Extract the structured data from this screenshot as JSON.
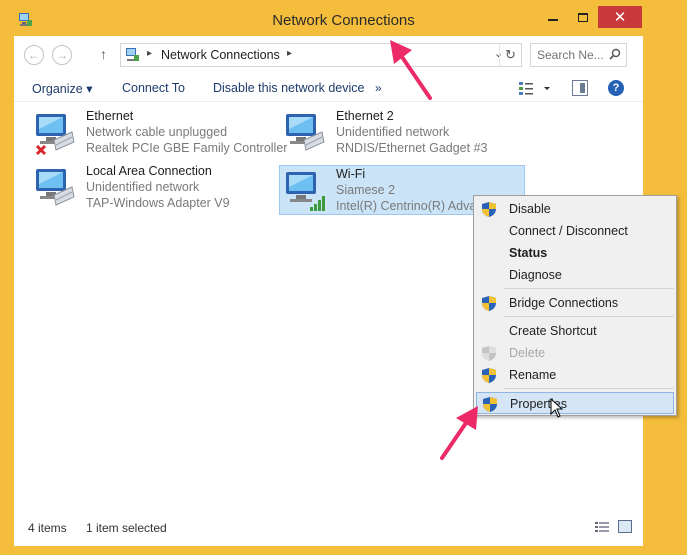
{
  "window": {
    "title": "Network Connections",
    "close_glyph": "✕"
  },
  "address": {
    "path": "Network Connections",
    "sep": "▸",
    "dropdown": "⌄",
    "refresh": "↻"
  },
  "search": {
    "placeholder": "Search Ne..."
  },
  "nav": {
    "back": "←",
    "forward": "→",
    "up": "↑"
  },
  "toolbar": {
    "organize": "Organize ▾",
    "connect_to": "Connect To",
    "disable_device": "Disable this network device",
    "more": "»",
    "help": "?"
  },
  "connections": [
    {
      "name": "Ethernet",
      "status": "Network cable unplugged",
      "device": "Realtek PCIe GBE Family Controller",
      "icon": "wired-disconnected-icon"
    },
    {
      "name": "Ethernet 2",
      "status": "Unidentified network",
      "device": "RNDIS/Ethernet Gadget #3",
      "icon": "wired-network-icon"
    },
    {
      "name": "Local Area Connection",
      "status": "Unidentified network",
      "device": "TAP-Windows Adapter V9",
      "icon": "wired-network-icon"
    },
    {
      "name": "Wi-Fi",
      "status": "Siamese  2",
      "device": "Intel(R) Centrino(R) Advan",
      "icon": "wifi-network-icon",
      "selected": true
    }
  ],
  "context_menu": {
    "items": [
      {
        "label": "Disable",
        "shield": true
      },
      {
        "label": "Connect / Disconnect",
        "shield": false
      },
      {
        "label": "Status",
        "shield": false,
        "bold": true
      },
      {
        "label": "Diagnose",
        "shield": false
      },
      {
        "label": "Bridge Connections",
        "shield": true
      },
      {
        "label": "Create Shortcut",
        "shield": false
      },
      {
        "label": "Delete",
        "shield": true,
        "disabled": true
      },
      {
        "label": "Rename",
        "shield": true
      },
      {
        "label": "Properties",
        "shield": true,
        "hover": true
      }
    ]
  },
  "statusbar": {
    "count": "4 items",
    "selected": "1 item selected"
  },
  "colors": {
    "chrome": "#f4bd3c",
    "close_button": "#c8393b",
    "selection": "#cce4f7",
    "annotation_arrow": "#ec2a68"
  }
}
